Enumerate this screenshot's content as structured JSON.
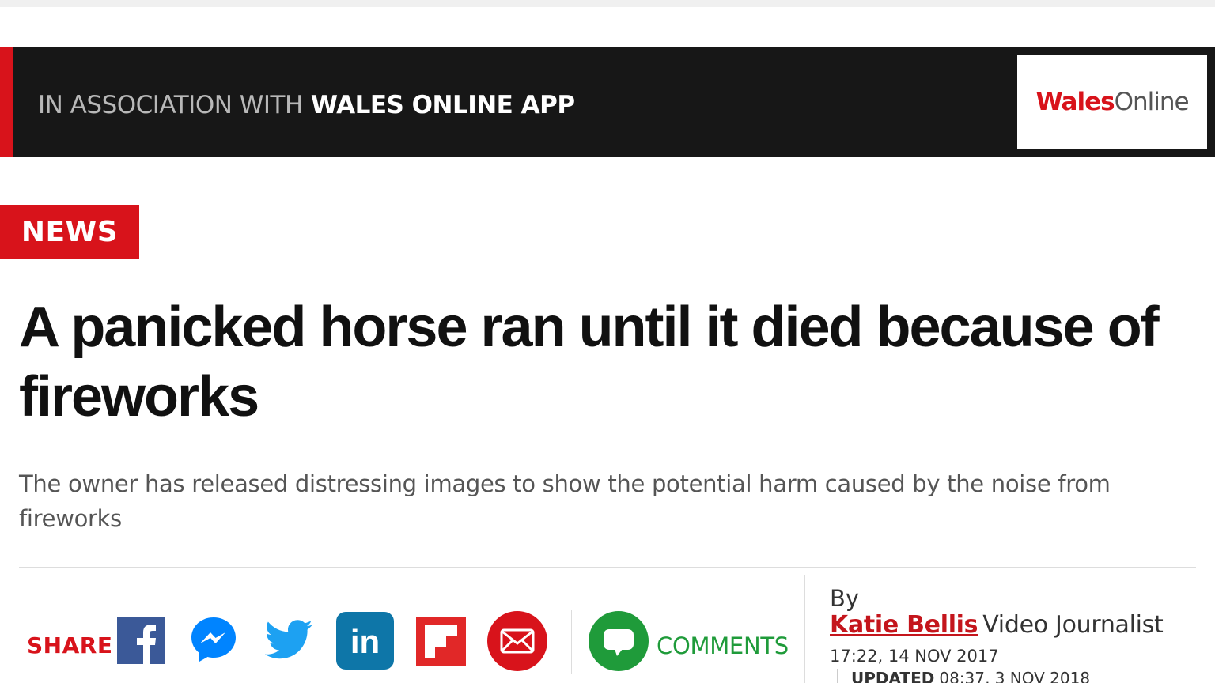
{
  "promo_bar": {
    "prefix": "IN ASSOCIATION WITH",
    "highlight": "WALES ONLINE APP",
    "logo": {
      "part1": "Wales",
      "part2": "Online"
    },
    "accent_color": "#d8131b"
  },
  "article": {
    "section": "NEWS",
    "headline": "A panicked horse ran until it died because of fireworks",
    "standfirst": "The owner has released distressing images to show the potential harm caused by the noise from fireworks"
  },
  "share": {
    "label": "SHARE",
    "icons": [
      "facebook-icon",
      "messenger-icon",
      "twitter-icon",
      "linkedin-icon",
      "flipboard-icon",
      "email-icon"
    ],
    "comments_label": "COMMENTS"
  },
  "byline": {
    "by": "By",
    "author": "Katie Bellis",
    "role": "Video Journalist",
    "published": "17:22, 14 NOV 2017",
    "updated_label": "UPDATED",
    "updated": "08:37, 3 NOV 2018"
  },
  "colors": {
    "brand_red": "#d8131b",
    "facebook": "#3b5998",
    "messenger": "#0084ff",
    "twitter": "#1da1f2",
    "linkedin": "#0e76a8",
    "flipboard": "#e12828",
    "email": "#d8131b",
    "comments": "#1f9b3a"
  }
}
